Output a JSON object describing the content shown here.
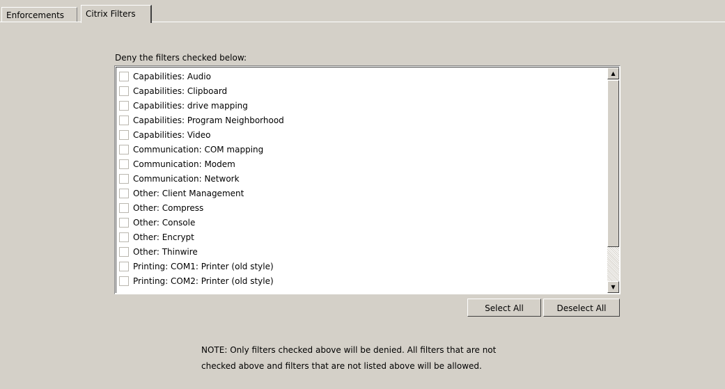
{
  "tabs": [
    {
      "label": "Enforcements",
      "active": false
    },
    {
      "label": "Citrix Filters",
      "active": true
    }
  ],
  "list_label": "Deny the filters checked below:",
  "filters": [
    {
      "label": "Capabilities:  Audio",
      "checked": false
    },
    {
      "label": "Capabilities:  Clipboard",
      "checked": false
    },
    {
      "label": "Capabilities:  drive mapping",
      "checked": false
    },
    {
      "label": "Capabilities:  Program Neighborhood",
      "checked": false
    },
    {
      "label": "Capabilities:  Video",
      "checked": false
    },
    {
      "label": "Communication:  COM mapping",
      "checked": false
    },
    {
      "label": "Communication:  Modem",
      "checked": false
    },
    {
      "label": "Communication:  Network",
      "checked": false
    },
    {
      "label": "Other:  Client Management",
      "checked": false
    },
    {
      "label": "Other:  Compress",
      "checked": false
    },
    {
      "label": "Other:  Console",
      "checked": false
    },
    {
      "label": "Other:  Encrypt",
      "checked": false
    },
    {
      "label": "Other:  Thinwire",
      "checked": false
    },
    {
      "label": "Printing:  COM1: Printer (old style)",
      "checked": false
    },
    {
      "label": "Printing:  COM2: Printer (old style)",
      "checked": false
    }
  ],
  "buttons": {
    "select_all": "Select All",
    "deselect_all": "Deselect All"
  },
  "note": {
    "line1": "NOTE: Only filters checked above will be denied.  All filters that are not",
    "line2": "checked above and filters that are not listed above will be allowed."
  },
  "scrollbar": {
    "up_icon": "arrow-up-icon",
    "down_icon": "arrow-down-icon"
  }
}
